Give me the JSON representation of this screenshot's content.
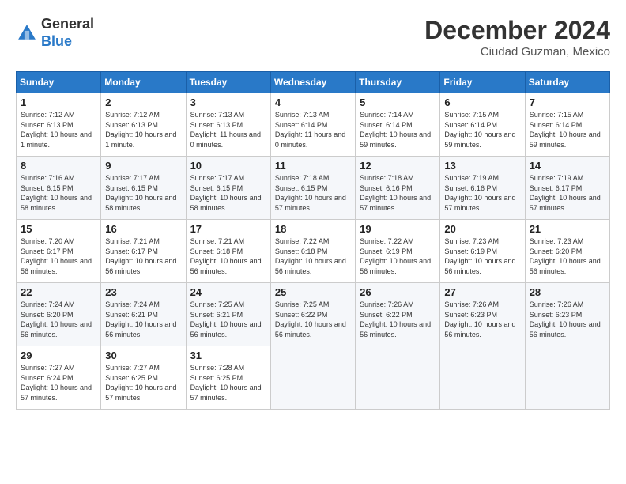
{
  "logo": {
    "general": "General",
    "blue": "Blue"
  },
  "header": {
    "month": "December 2024",
    "location": "Ciudad Guzman, Mexico"
  },
  "weekdays": [
    "Sunday",
    "Monday",
    "Tuesday",
    "Wednesday",
    "Thursday",
    "Friday",
    "Saturday"
  ],
  "weeks": [
    [
      {
        "day": 1,
        "sunrise": "7:12 AM",
        "sunset": "6:13 PM",
        "daylight": "10 hours and 1 minute"
      },
      {
        "day": 2,
        "sunrise": "7:12 AM",
        "sunset": "6:13 PM",
        "daylight": "10 hours and 1 minute"
      },
      {
        "day": 3,
        "sunrise": "7:13 AM",
        "sunset": "6:13 PM",
        "daylight": "11 hours and 0 minutes"
      },
      {
        "day": 4,
        "sunrise": "7:13 AM",
        "sunset": "6:14 PM",
        "daylight": "11 hours and 0 minutes"
      },
      {
        "day": 5,
        "sunrise": "7:14 AM",
        "sunset": "6:14 PM",
        "daylight": "10 hours and 59 minutes"
      },
      {
        "day": 6,
        "sunrise": "7:15 AM",
        "sunset": "6:14 PM",
        "daylight": "10 hours and 59 minutes"
      },
      {
        "day": 7,
        "sunrise": "7:15 AM",
        "sunset": "6:14 PM",
        "daylight": "10 hours and 59 minutes"
      }
    ],
    [
      {
        "day": 8,
        "sunrise": "7:16 AM",
        "sunset": "6:15 PM",
        "daylight": "10 hours and 58 minutes"
      },
      {
        "day": 9,
        "sunrise": "7:17 AM",
        "sunset": "6:15 PM",
        "daylight": "10 hours and 58 minutes"
      },
      {
        "day": 10,
        "sunrise": "7:17 AM",
        "sunset": "6:15 PM",
        "daylight": "10 hours and 58 minutes"
      },
      {
        "day": 11,
        "sunrise": "7:18 AM",
        "sunset": "6:15 PM",
        "daylight": "10 hours and 57 minutes"
      },
      {
        "day": 12,
        "sunrise": "7:18 AM",
        "sunset": "6:16 PM",
        "daylight": "10 hours and 57 minutes"
      },
      {
        "day": 13,
        "sunrise": "7:19 AM",
        "sunset": "6:16 PM",
        "daylight": "10 hours and 57 minutes"
      },
      {
        "day": 14,
        "sunrise": "7:19 AM",
        "sunset": "6:17 PM",
        "daylight": "10 hours and 57 minutes"
      }
    ],
    [
      {
        "day": 15,
        "sunrise": "7:20 AM",
        "sunset": "6:17 PM",
        "daylight": "10 hours and 56 minutes"
      },
      {
        "day": 16,
        "sunrise": "7:21 AM",
        "sunset": "6:17 PM",
        "daylight": "10 hours and 56 minutes"
      },
      {
        "day": 17,
        "sunrise": "7:21 AM",
        "sunset": "6:18 PM",
        "daylight": "10 hours and 56 minutes"
      },
      {
        "day": 18,
        "sunrise": "7:22 AM",
        "sunset": "6:18 PM",
        "daylight": "10 hours and 56 minutes"
      },
      {
        "day": 19,
        "sunrise": "7:22 AM",
        "sunset": "6:19 PM",
        "daylight": "10 hours and 56 minutes"
      },
      {
        "day": 20,
        "sunrise": "7:23 AM",
        "sunset": "6:19 PM",
        "daylight": "10 hours and 56 minutes"
      },
      {
        "day": 21,
        "sunrise": "7:23 AM",
        "sunset": "6:20 PM",
        "daylight": "10 hours and 56 minutes"
      }
    ],
    [
      {
        "day": 22,
        "sunrise": "7:24 AM",
        "sunset": "6:20 PM",
        "daylight": "10 hours and 56 minutes"
      },
      {
        "day": 23,
        "sunrise": "7:24 AM",
        "sunset": "6:21 PM",
        "daylight": "10 hours and 56 minutes"
      },
      {
        "day": 24,
        "sunrise": "7:25 AM",
        "sunset": "6:21 PM",
        "daylight": "10 hours and 56 minutes"
      },
      {
        "day": 25,
        "sunrise": "7:25 AM",
        "sunset": "6:22 PM",
        "daylight": "10 hours and 56 minutes"
      },
      {
        "day": 26,
        "sunrise": "7:26 AM",
        "sunset": "6:22 PM",
        "daylight": "10 hours and 56 minutes"
      },
      {
        "day": 27,
        "sunrise": "7:26 AM",
        "sunset": "6:23 PM",
        "daylight": "10 hours and 56 minutes"
      },
      {
        "day": 28,
        "sunrise": "7:26 AM",
        "sunset": "6:23 PM",
        "daylight": "10 hours and 56 minutes"
      }
    ],
    [
      {
        "day": 29,
        "sunrise": "7:27 AM",
        "sunset": "6:24 PM",
        "daylight": "10 hours and 57 minutes"
      },
      {
        "day": 30,
        "sunrise": "7:27 AM",
        "sunset": "6:25 PM",
        "daylight": "10 hours and 57 minutes"
      },
      {
        "day": 31,
        "sunrise": "7:28 AM",
        "sunset": "6:25 PM",
        "daylight": "10 hours and 57 minutes"
      },
      null,
      null,
      null,
      null
    ]
  ]
}
